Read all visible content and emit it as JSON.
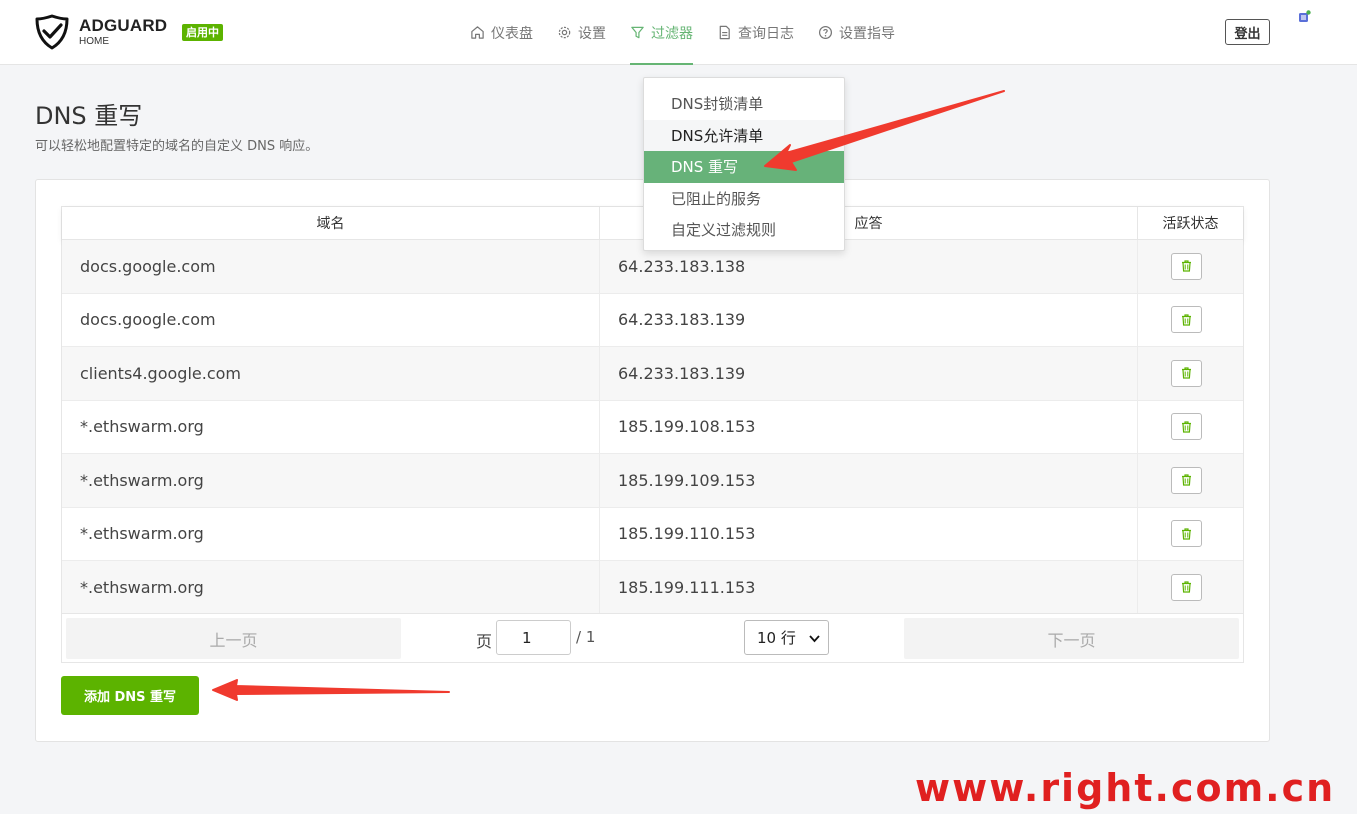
{
  "brand": {
    "title": "ADGUARD",
    "subtitle": "HOME",
    "status_badge": "启用中"
  },
  "nav": {
    "items": [
      {
        "label": "仪表盘",
        "icon": "home-icon"
      },
      {
        "label": "设置",
        "icon": "gear-icon"
      },
      {
        "label": "过滤器",
        "icon": "filter-icon",
        "active": true
      },
      {
        "label": "查询日志",
        "icon": "document-icon"
      },
      {
        "label": "设置指导",
        "icon": "help-circle-icon"
      }
    ],
    "logout_label": "登出"
  },
  "dropdown": {
    "items": [
      {
        "label": "DNS封锁清单"
      },
      {
        "label": "DNS允许清单"
      },
      {
        "label": "DNS 重写"
      },
      {
        "label": "已阻止的服务"
      },
      {
        "label": "自定义过滤规则"
      }
    ]
  },
  "page": {
    "title": "DNS 重写",
    "subtitle": "可以轻松地配置特定的域名的自定义 DNS 响应。"
  },
  "table": {
    "headers": [
      "域名",
      "应答",
      "活跃状态"
    ],
    "rows": [
      {
        "domain": "docs.google.com",
        "answer": "64.233.183.138"
      },
      {
        "domain": "docs.google.com",
        "answer": "64.233.183.139"
      },
      {
        "domain": "clients4.google.com",
        "answer": "64.233.183.139"
      },
      {
        "domain": "*.ethswarm.org",
        "answer": "185.199.108.153"
      },
      {
        "domain": "*.ethswarm.org",
        "answer": "185.199.109.153"
      },
      {
        "domain": "*.ethswarm.org",
        "answer": "185.199.110.153"
      },
      {
        "domain": "*.ethswarm.org",
        "answer": "185.199.111.153"
      }
    ]
  },
  "pagination": {
    "prev_label": "上一页",
    "page_label": "页",
    "page_value": "1",
    "total": "/ 1",
    "rows_select": "10 行",
    "next_label": "下一页"
  },
  "add_button_label": "添加 DNS 重写",
  "watermark": "www.right.com.cn",
  "colors": {
    "accent": "#5cb300",
    "nav_active": "#66b574",
    "arrow": "#f03a2e"
  }
}
